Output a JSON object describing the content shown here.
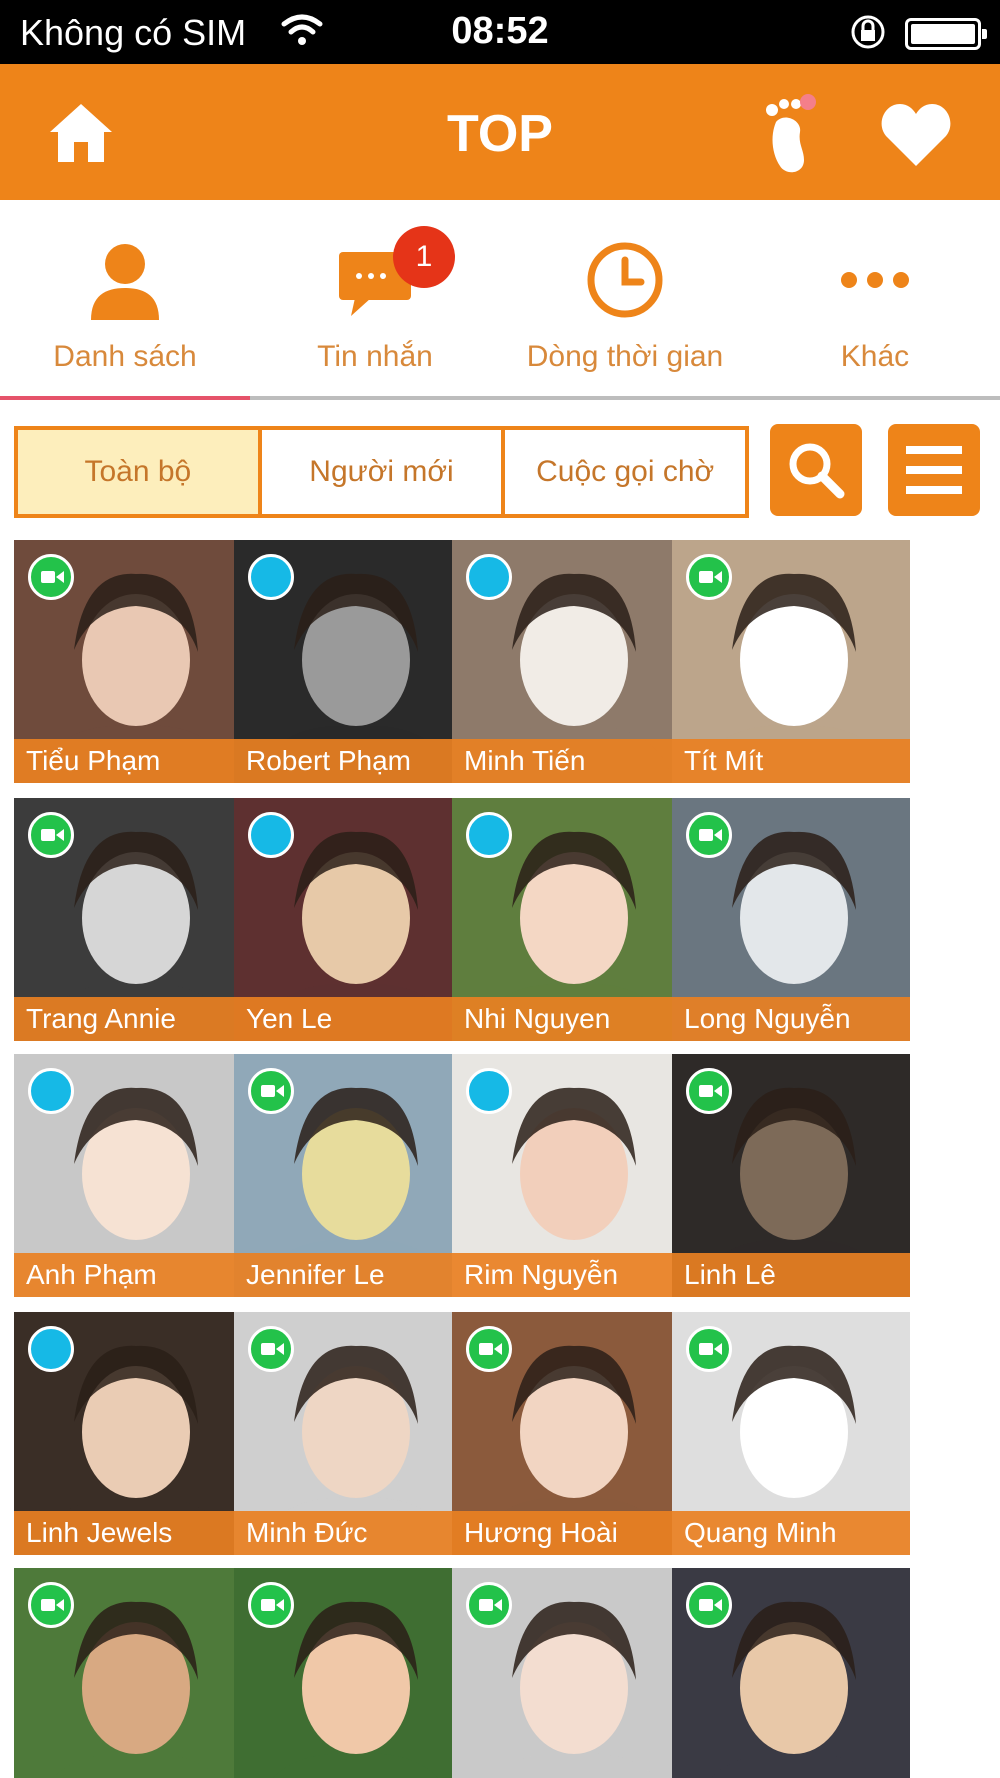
{
  "status_bar": {
    "carrier": "Không có SIM",
    "time": "08:52"
  },
  "header": {
    "title": "TOP",
    "icons": [
      "home-icon",
      "footprint-icon",
      "heart-icon"
    ]
  },
  "nav": {
    "items": [
      {
        "label": "Danh sách",
        "icon": "person-icon"
      },
      {
        "label": "Tin nhắn",
        "icon": "chat-bubble-icon"
      },
      {
        "label": "Dòng thời gian",
        "icon": "clock-icon"
      },
      {
        "label": "Khác",
        "icon": "more-dots-icon"
      }
    ],
    "message_badge": "1",
    "active_tab": "Danh sách"
  },
  "filter": {
    "tabs": [
      "Toàn bộ",
      "Người mới",
      "Cuộc gọi chờ"
    ],
    "selected": "Toàn bộ",
    "icons": [
      "search-icon",
      "menu-icon"
    ]
  },
  "profiles": [
    {
      "name": "Tiểu Phạm",
      "status": "video"
    },
    {
      "name": "Robert Phạm",
      "status": "chat"
    },
    {
      "name": "Minh Tiến",
      "status": "chat"
    },
    {
      "name": "Tít Mít",
      "status": "video"
    },
    {
      "name": "Trang Annie",
      "status": "video"
    },
    {
      "name": "Yen Le",
      "status": "chat"
    },
    {
      "name": "Nhi Nguyen",
      "status": "chat"
    },
    {
      "name": "Long Nguyễn",
      "status": "video"
    },
    {
      "name": "Anh Phạm",
      "status": "chat"
    },
    {
      "name": "Jennifer Le",
      "status": "video"
    },
    {
      "name": "Rim Nguyễn",
      "status": "chat"
    },
    {
      "name": "Linh Lê",
      "status": "video"
    },
    {
      "name": "Linh Jewels",
      "status": "chat"
    },
    {
      "name": "Minh Đức",
      "status": "video"
    },
    {
      "name": "Hương Hoài",
      "status": "video"
    },
    {
      "name": "Quang Minh",
      "status": "video"
    },
    {
      "name": "",
      "status": "video"
    },
    {
      "name": "",
      "status": "video"
    },
    {
      "name": "",
      "status": "video"
    },
    {
      "name": "",
      "status": "video"
    }
  ],
  "colors": {
    "accent": "#ee8419",
    "badge": "#e53418",
    "video": "#23c24a",
    "chat": "#16b9e6"
  }
}
